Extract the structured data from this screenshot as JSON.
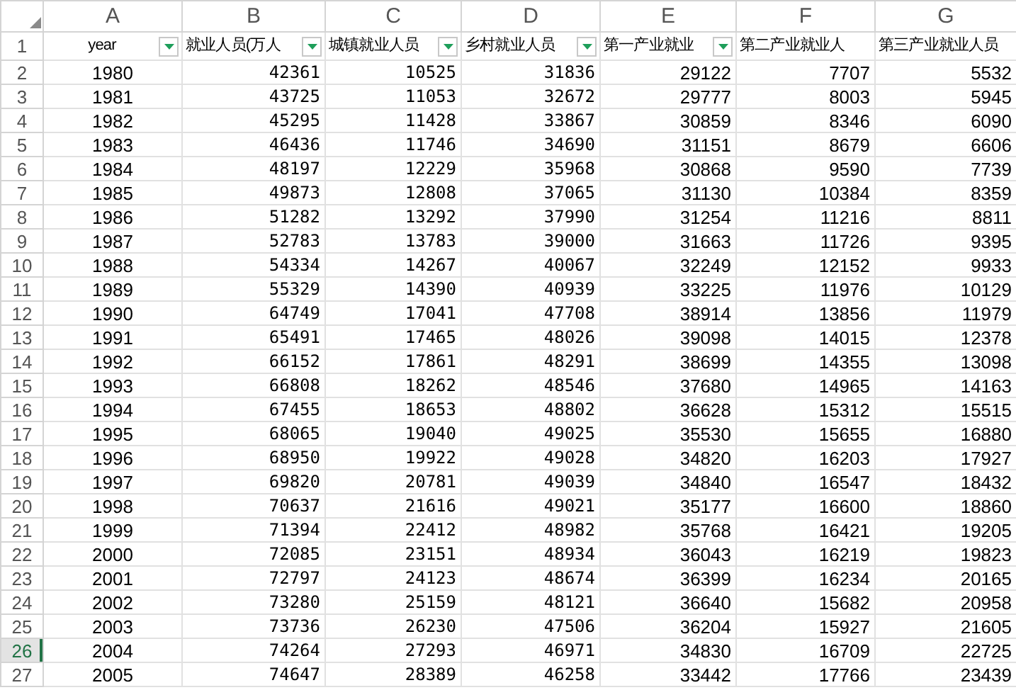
{
  "column_letters": [
    "A",
    "B",
    "C",
    "D",
    "E",
    "F",
    "G"
  ],
  "header_row": {
    "number": "1",
    "selected": false,
    "cells": [
      {
        "text": "year",
        "filter": true
      },
      {
        "text": "就业人员(万人",
        "filter": true
      },
      {
        "text": "城镇就业人员",
        "filter": true
      },
      {
        "text": "乡村就业人员",
        "filter": true
      },
      {
        "text": "第一产业就业",
        "filter": true
      },
      {
        "text": "第二产业就业人",
        "filter": false
      },
      {
        "text": "第三产业就业人员",
        "filter": false
      }
    ]
  },
  "rows": [
    {
      "number": "2",
      "selected": false,
      "cells": [
        "1980",
        "42361",
        "10525",
        "31836",
        "29122",
        "7707",
        "5532"
      ]
    },
    {
      "number": "3",
      "selected": false,
      "cells": [
        "1981",
        "43725",
        "11053",
        "32672",
        "29777",
        "8003",
        "5945"
      ]
    },
    {
      "number": "4",
      "selected": false,
      "cells": [
        "1982",
        "45295",
        "11428",
        "33867",
        "30859",
        "8346",
        "6090"
      ]
    },
    {
      "number": "5",
      "selected": false,
      "cells": [
        "1983",
        "46436",
        "11746",
        "34690",
        "31151",
        "8679",
        "6606"
      ]
    },
    {
      "number": "6",
      "selected": false,
      "cells": [
        "1984",
        "48197",
        "12229",
        "35968",
        "30868",
        "9590",
        "7739"
      ]
    },
    {
      "number": "7",
      "selected": false,
      "cells": [
        "1985",
        "49873",
        "12808",
        "37065",
        "31130",
        "10384",
        "8359"
      ]
    },
    {
      "number": "8",
      "selected": false,
      "cells": [
        "1986",
        "51282",
        "13292",
        "37990",
        "31254",
        "11216",
        "8811"
      ]
    },
    {
      "number": "9",
      "selected": false,
      "cells": [
        "1987",
        "52783",
        "13783",
        "39000",
        "31663",
        "11726",
        "9395"
      ]
    },
    {
      "number": "10",
      "selected": false,
      "cells": [
        "1988",
        "54334",
        "14267",
        "40067",
        "32249",
        "12152",
        "9933"
      ]
    },
    {
      "number": "11",
      "selected": false,
      "cells": [
        "1989",
        "55329",
        "14390",
        "40939",
        "33225",
        "11976",
        "10129"
      ]
    },
    {
      "number": "12",
      "selected": false,
      "cells": [
        "1990",
        "64749",
        "17041",
        "47708",
        "38914",
        "13856",
        "11979"
      ]
    },
    {
      "number": "13",
      "selected": false,
      "cells": [
        "1991",
        "65491",
        "17465",
        "48026",
        "39098",
        "14015",
        "12378"
      ]
    },
    {
      "number": "14",
      "selected": false,
      "cells": [
        "1992",
        "66152",
        "17861",
        "48291",
        "38699",
        "14355",
        "13098"
      ]
    },
    {
      "number": "15",
      "selected": false,
      "cells": [
        "1993",
        "66808",
        "18262",
        "48546",
        "37680",
        "14965",
        "14163"
      ]
    },
    {
      "number": "16",
      "selected": false,
      "cells": [
        "1994",
        "67455",
        "18653",
        "48802",
        "36628",
        "15312",
        "15515"
      ]
    },
    {
      "number": "17",
      "selected": false,
      "cells": [
        "1995",
        "68065",
        "19040",
        "49025",
        "35530",
        "15655",
        "16880"
      ]
    },
    {
      "number": "18",
      "selected": false,
      "cells": [
        "1996",
        "68950",
        "19922",
        "49028",
        "34820",
        "16203",
        "17927"
      ]
    },
    {
      "number": "19",
      "selected": false,
      "cells": [
        "1997",
        "69820",
        "20781",
        "49039",
        "34840",
        "16547",
        "18432"
      ]
    },
    {
      "number": "20",
      "selected": false,
      "cells": [
        "1998",
        "70637",
        "21616",
        "49021",
        "35177",
        "16600",
        "18860"
      ]
    },
    {
      "number": "21",
      "selected": false,
      "cells": [
        "1999",
        "71394",
        "22412",
        "48982",
        "35768",
        "16421",
        "19205"
      ]
    },
    {
      "number": "22",
      "selected": false,
      "cells": [
        "2000",
        "72085",
        "23151",
        "48934",
        "36043",
        "16219",
        "19823"
      ]
    },
    {
      "number": "23",
      "selected": false,
      "cells": [
        "2001",
        "72797",
        "24123",
        "48674",
        "36399",
        "16234",
        "20165"
      ]
    },
    {
      "number": "24",
      "selected": false,
      "cells": [
        "2002",
        "73280",
        "25159",
        "48121",
        "36640",
        "15682",
        "20958"
      ]
    },
    {
      "number": "25",
      "selected": false,
      "cells": [
        "2003",
        "73736",
        "26230",
        "47506",
        "36204",
        "15927",
        "21605"
      ]
    },
    {
      "number": "26",
      "selected": true,
      "cells": [
        "2004",
        "74264",
        "27293",
        "46971",
        "34830",
        "16709",
        "22725"
      ]
    },
    {
      "number": "27",
      "selected": false,
      "cells": [
        "2005",
        "74647",
        "28389",
        "46258",
        "33442",
        "17766",
        "23439"
      ]
    }
  ]
}
